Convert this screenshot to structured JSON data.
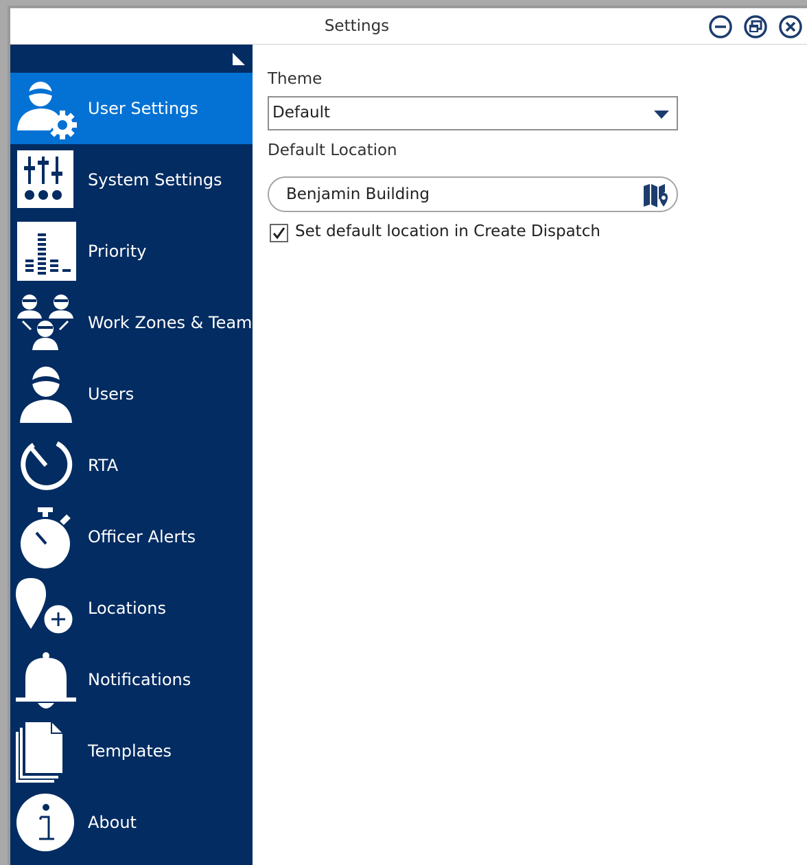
{
  "window": {
    "title": "Settings"
  },
  "sidebar": {
    "items": [
      {
        "label": "User Settings",
        "icon": "user-gear-icon",
        "selected": true
      },
      {
        "label": "System Settings",
        "icon": "sliders-icon",
        "selected": false
      },
      {
        "label": "Priority",
        "icon": "priority-bars-icon",
        "selected": false
      },
      {
        "label": "Work Zones & Teams",
        "icon": "team-icon",
        "selected": false
      },
      {
        "label": "Users",
        "icon": "user-icon",
        "selected": false
      },
      {
        "label": "RTA",
        "icon": "timer-icon",
        "selected": false
      },
      {
        "label": "Officer Alerts",
        "icon": "stopwatch-icon",
        "selected": false
      },
      {
        "label": "Locations",
        "icon": "location-add-icon",
        "selected": false
      },
      {
        "label": "Notifications",
        "icon": "bell-icon",
        "selected": false
      },
      {
        "label": "Templates",
        "icon": "documents-icon",
        "selected": false
      },
      {
        "label": "About",
        "icon": "info-icon",
        "selected": false
      }
    ]
  },
  "user_settings": {
    "theme_label": "Theme",
    "theme_value": "Default",
    "default_location_label": "Default Location",
    "default_location_value": "Benjamin Building",
    "checkbox_label": "Set default location in Create Dispatch",
    "checkbox_checked": true
  },
  "colors": {
    "sidebar_bg": "#032c62",
    "selected_bg": "#0472d4",
    "accent": "#1d3c6e"
  }
}
